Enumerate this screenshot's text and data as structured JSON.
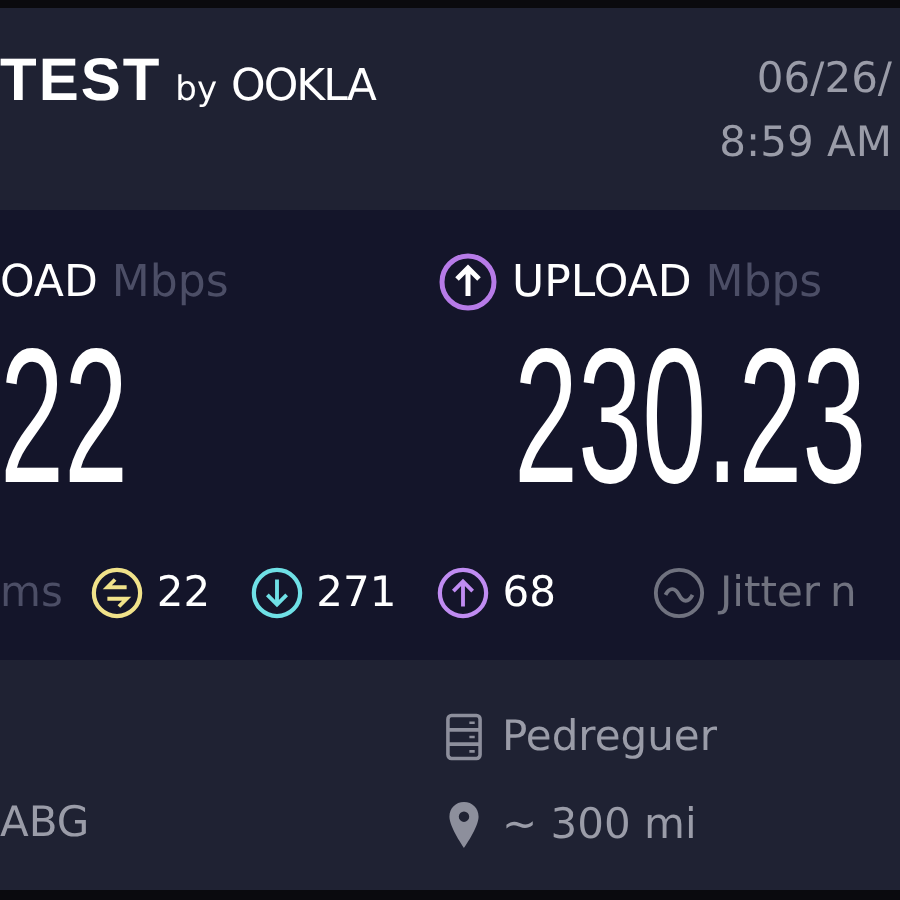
{
  "header": {
    "logo": {
      "word": "TEST",
      "by": "by",
      "brand": "OOKLA"
    },
    "date": "06/26/",
    "time": "8:59 AM"
  },
  "download": {
    "label": "OAD",
    "unit": "Mbps",
    "value": "22"
  },
  "upload": {
    "label": "UPLOAD",
    "unit": "Mbps",
    "value": "230.23"
  },
  "ping_unit": "ms",
  "latency": [
    {
      "kind": "idle",
      "value": "22"
    },
    {
      "kind": "down",
      "value": "271"
    },
    {
      "kind": "up",
      "value": "68"
    }
  ],
  "jitter": {
    "label": "Jitter",
    "unit": "n"
  },
  "footer": {
    "isp": "ABG",
    "server": "Pedreguer",
    "distance": "~ 300 mi"
  }
}
